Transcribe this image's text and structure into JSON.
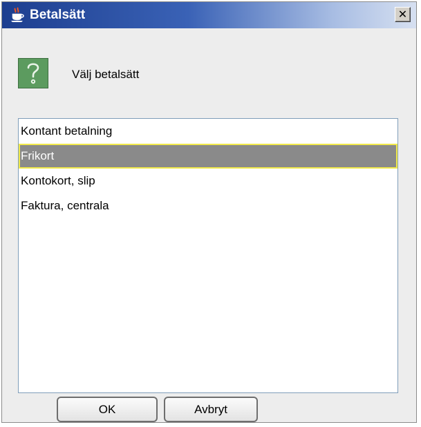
{
  "window": {
    "title": "Betalsätt",
    "close_glyph": "✕",
    "app_icon": "java-coffee-cup-icon",
    "title_gradient": [
      "#1d3e8f",
      "#d6e0f1"
    ]
  },
  "dialog": {
    "icon": "question-icon",
    "prompt": "Välj betalsätt"
  },
  "list": {
    "items": [
      {
        "label": "Kontant betalning",
        "selected": false
      },
      {
        "label": "Frikort",
        "selected": true
      },
      {
        "label": "Kontokort, slip",
        "selected": false
      },
      {
        "label": "Faktura, centrala",
        "selected": false
      }
    ],
    "selection_color": "#8a8a8a",
    "focus_border_color": "#f2e94a"
  },
  "buttons": {
    "ok_label": "OK",
    "cancel_label": "Avbryt"
  }
}
